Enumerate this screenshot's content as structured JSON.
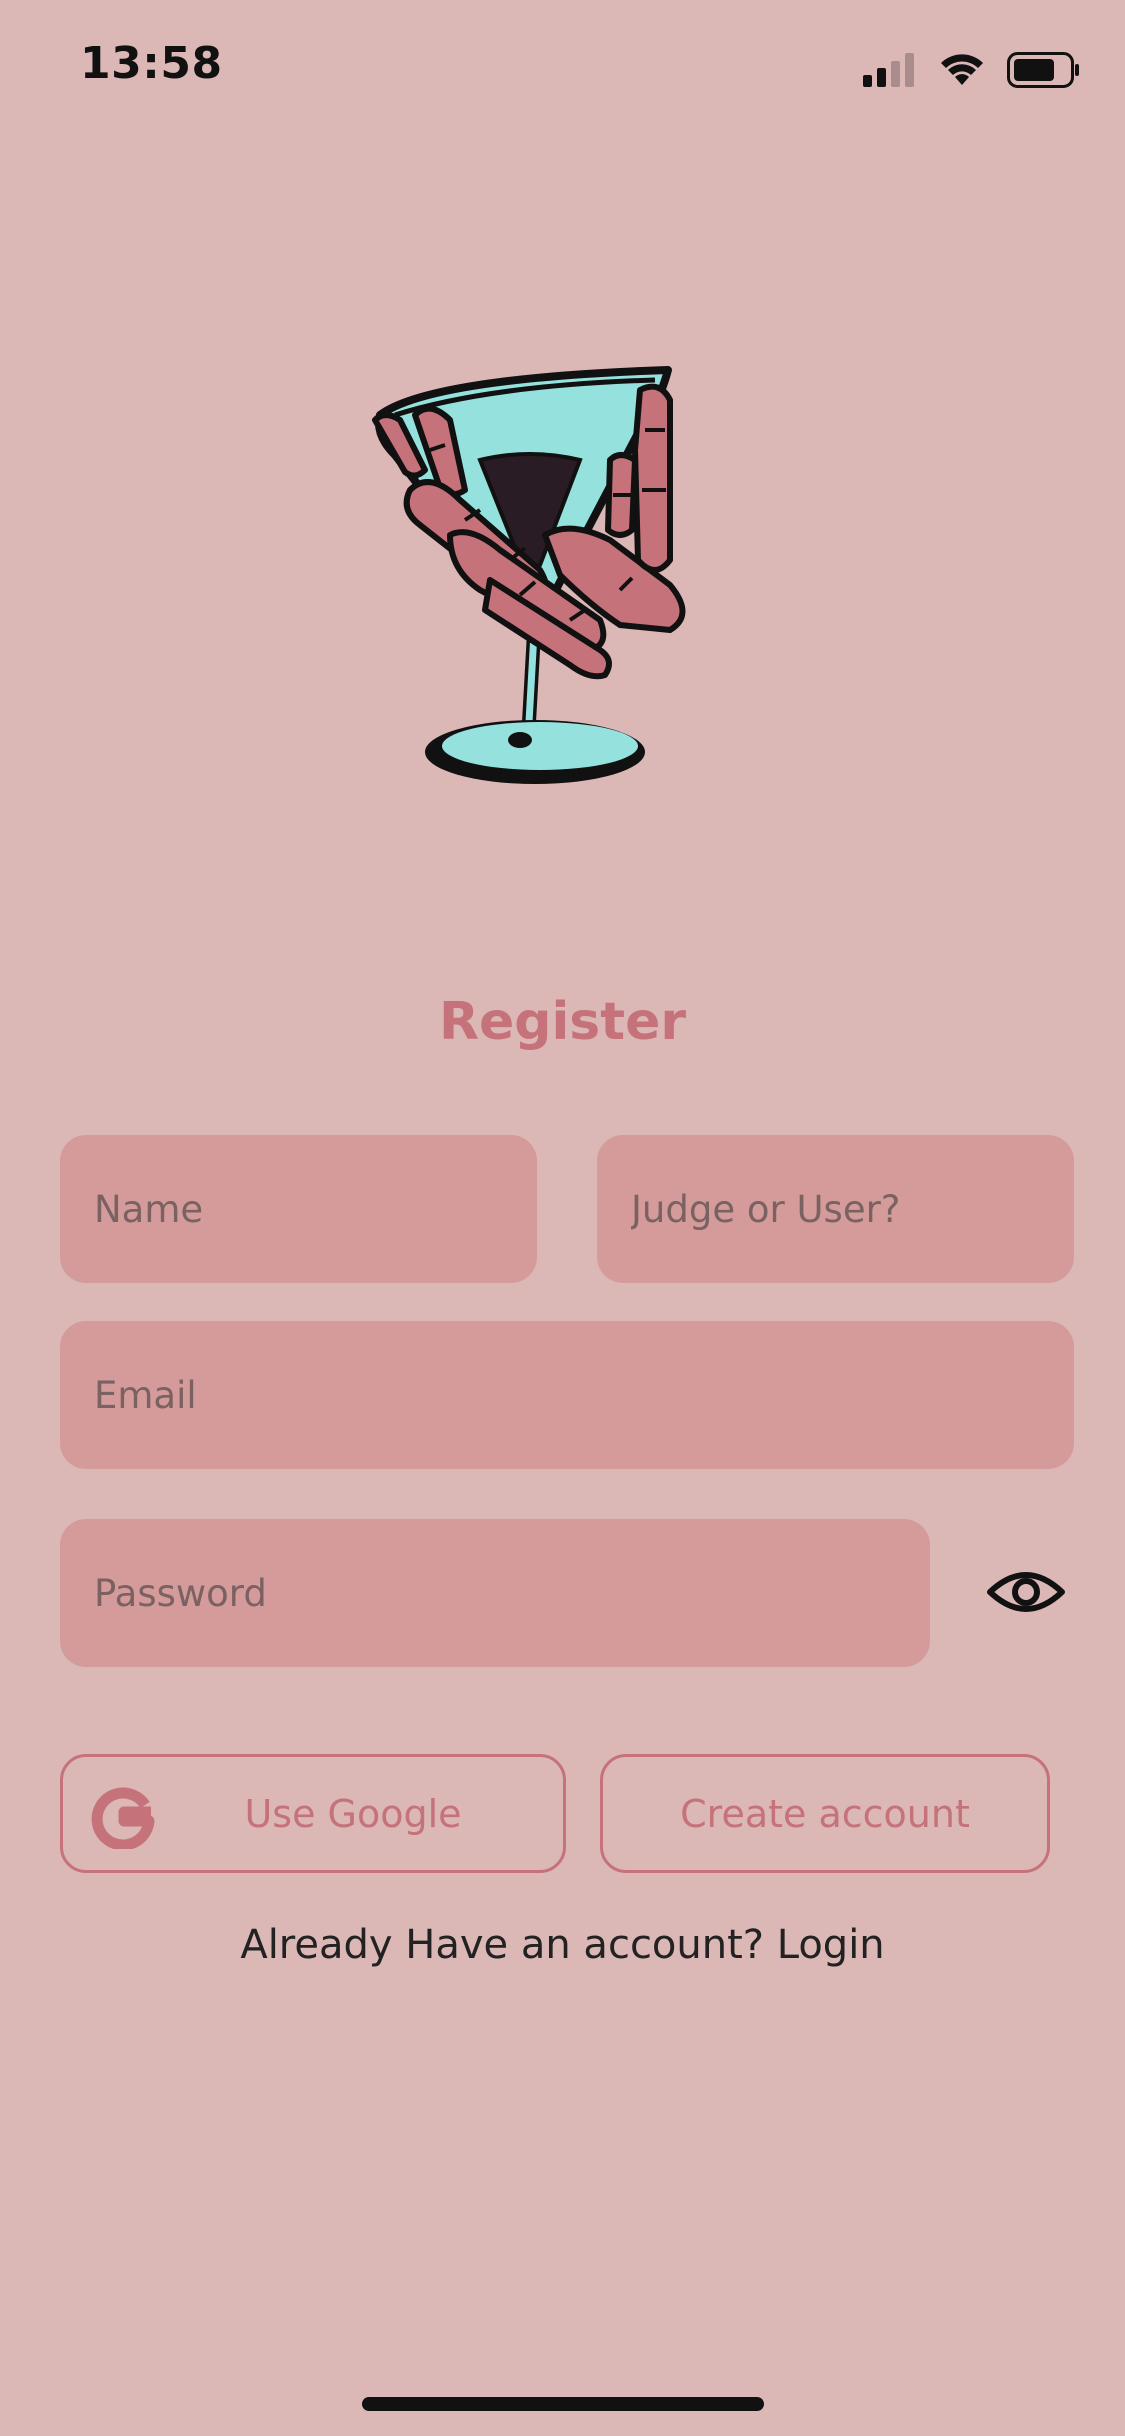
{
  "status_bar": {
    "time": "13:58",
    "icons": [
      "cellular-signal-icon",
      "wifi-icon",
      "battery-icon"
    ]
  },
  "logo": {
    "description_icon": "skeleton-hand-martini-logo"
  },
  "register": {
    "title": "Register",
    "name_placeholder": "Name",
    "role_placeholder": "Judge or User?",
    "email_placeholder": "Email",
    "password_placeholder": "Password",
    "password_toggle_icon": "eye-icon",
    "google_button_label": "Use Google",
    "google_icon": "google-g-icon",
    "create_button_label": "Create account",
    "login_prompt": "Already Have an account?",
    "login_link": "Login"
  },
  "colors": {
    "background": "#dbb7b6",
    "input_fill": "#d49b9a",
    "accent": "#c6727a",
    "text_dark": "#222222"
  }
}
